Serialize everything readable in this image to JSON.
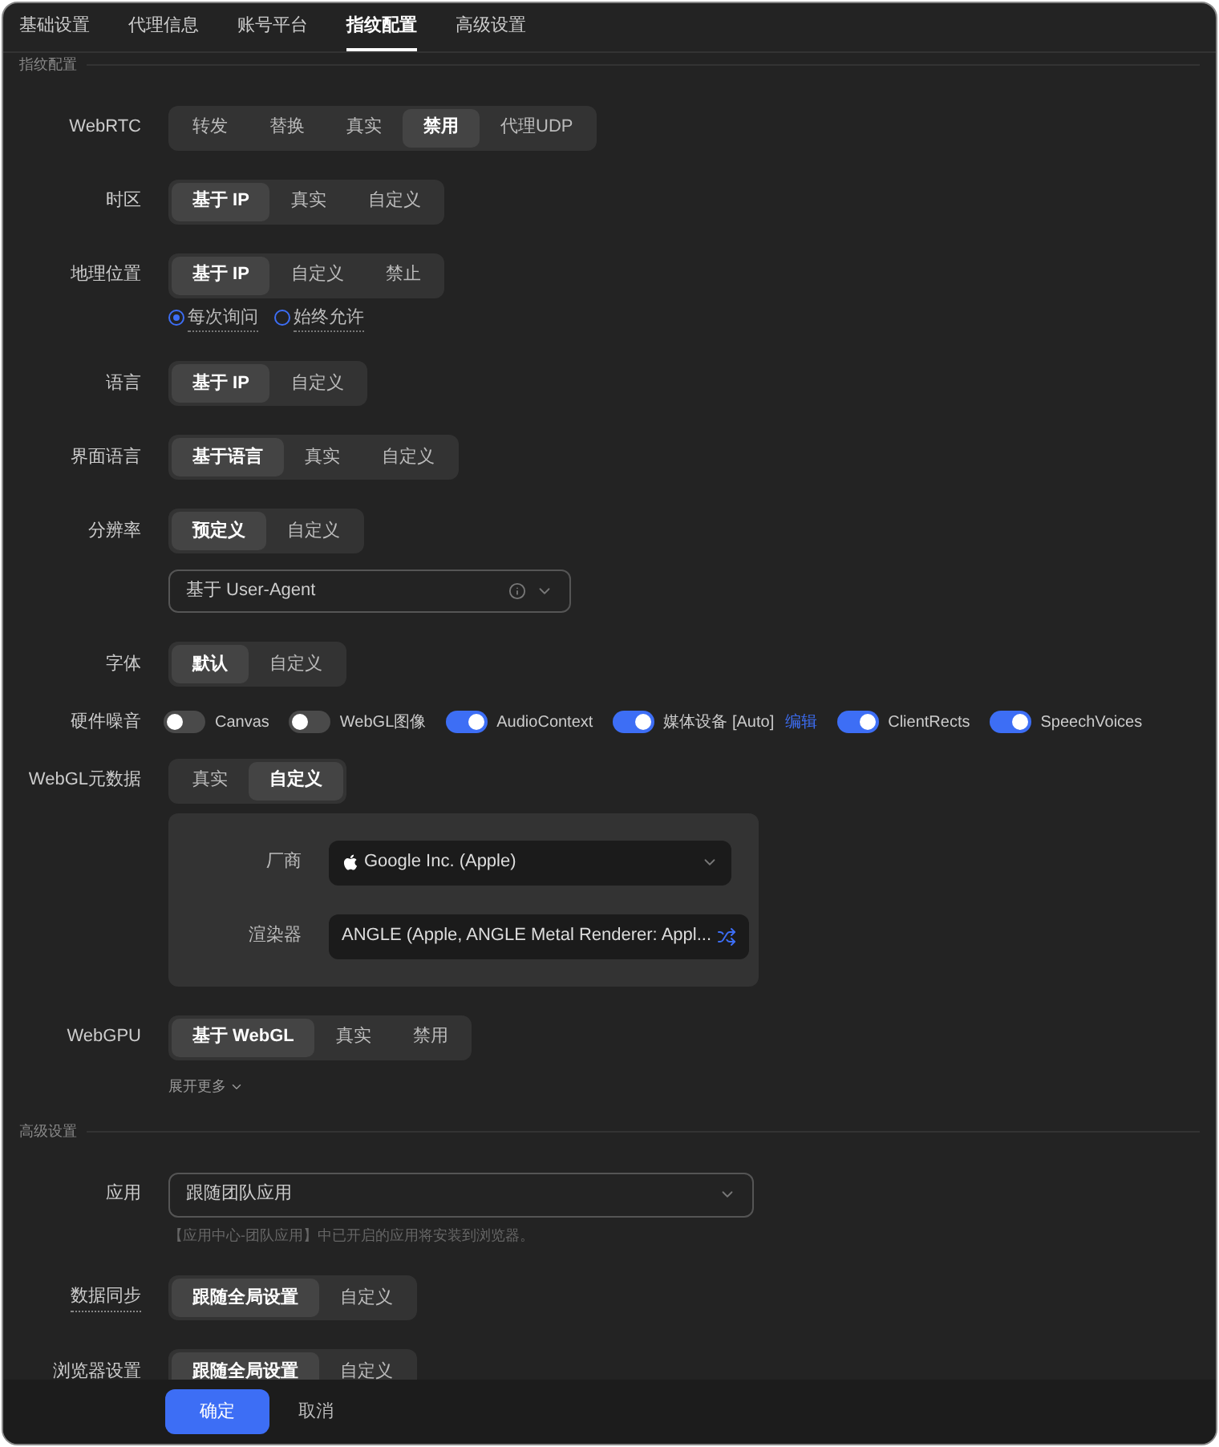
{
  "tabs": [
    {
      "label": "基础设置",
      "selected": false
    },
    {
      "label": "代理信息",
      "selected": false
    },
    {
      "label": "账号平台",
      "selected": false
    },
    {
      "label": "指纹配置",
      "selected": true
    },
    {
      "label": "高级设置",
      "selected": false
    }
  ],
  "sections": [
    {
      "title": "指纹配置",
      "rows": [
        {
          "kind": "segmented",
          "label": "WebRTC",
          "options": [
            {
              "label": "转发",
              "selected": false
            },
            {
              "label": "替换",
              "selected": false
            },
            {
              "label": "真实",
              "selected": false
            },
            {
              "label": "禁用",
              "selected": true
            },
            {
              "label": "代理UDP",
              "selected": false
            }
          ]
        },
        {
          "kind": "segmented",
          "label": "时区",
          "options": [
            {
              "label": "基于 IP",
              "selected": true
            },
            {
              "label": "真实",
              "selected": false
            },
            {
              "label": "自定义",
              "selected": false
            }
          ]
        },
        {
          "kind": "segmented",
          "label": "地理位置",
          "options": [
            {
              "label": "基于 IP",
              "selected": true
            },
            {
              "label": "自定义",
              "selected": false
            },
            {
              "label": "禁止",
              "selected": false
            }
          ],
          "radios": [
            {
              "label": "每次询问",
              "selected": true
            },
            {
              "label": "始终允许",
              "selected": false
            }
          ]
        },
        {
          "kind": "segmented",
          "label": "语言",
          "options": [
            {
              "label": "基于 IP",
              "selected": true
            },
            {
              "label": "自定义",
              "selected": false
            }
          ]
        },
        {
          "kind": "segmented",
          "label": "界面语言",
          "options": [
            {
              "label": "基于语言",
              "selected": true
            },
            {
              "label": "真实",
              "selected": false
            },
            {
              "label": "自定义",
              "selected": false
            }
          ]
        },
        {
          "kind": "segmented",
          "label": "分辨率",
          "options": [
            {
              "label": "预定义",
              "selected": true
            },
            {
              "label": "自定义",
              "selected": false
            }
          ],
          "select": {
            "value": "基于 User-Agent",
            "info": true
          }
        },
        {
          "kind": "segmented",
          "label": "字体",
          "options": [
            {
              "label": "默认",
              "selected": true
            },
            {
              "label": "自定义",
              "selected": false
            }
          ]
        },
        {
          "kind": "toggles",
          "label": "硬件噪音",
          "toggles": [
            {
              "label": "Canvas",
              "on": false
            },
            {
              "label": "WebGL图像",
              "on": false
            },
            {
              "label": "AudioContext",
              "on": true
            },
            {
              "label": "媒体设备 [Auto]",
              "on": true,
              "link": "编辑"
            },
            {
              "label": "ClientRects",
              "on": true
            },
            {
              "label": "SpeechVoices",
              "on": true
            }
          ]
        },
        {
          "kind": "segmented",
          "label": "WebGL元数据",
          "options": [
            {
              "label": "真实",
              "selected": false
            },
            {
              "label": "自定义",
              "selected": true
            }
          ],
          "panel": [
            {
              "kind": "select",
              "label": "厂商",
              "value": "Google Inc. (Apple)"
            },
            {
              "kind": "random",
              "label": "渲染器",
              "value": "ANGLE (Apple, ANGLE Metal Renderer: Appl..."
            }
          ]
        },
        {
          "kind": "segmented",
          "label": "WebGPU",
          "options": [
            {
              "label": "基于 WebGL",
              "selected": true
            },
            {
              "label": "真实",
              "selected": false
            },
            {
              "label": "禁用",
              "selected": false
            }
          ]
        },
        {
          "kind": "more",
          "label": "展开更多"
        }
      ]
    },
    {
      "title": "高级设置",
      "rows": [
        {
          "kind": "dropdown",
          "label": "应用",
          "value": "跟随团队应用",
          "hint": "【应用中心-团队应用】中已开启的应用将安装到浏览器。"
        },
        {
          "kind": "segmented",
          "label": "数据同步",
          "underline": true,
          "options": [
            {
              "label": "跟随全局设置",
              "selected": true
            },
            {
              "label": "自定义",
              "selected": false
            }
          ]
        },
        {
          "kind": "segmented",
          "label": "浏览器设置",
          "options": [
            {
              "label": "跟随全局设置",
              "selected": true
            },
            {
              "label": "自定义",
              "selected": false
            }
          ]
        }
      ]
    }
  ],
  "footer": {
    "confirm": "确定",
    "cancel": "取消"
  }
}
